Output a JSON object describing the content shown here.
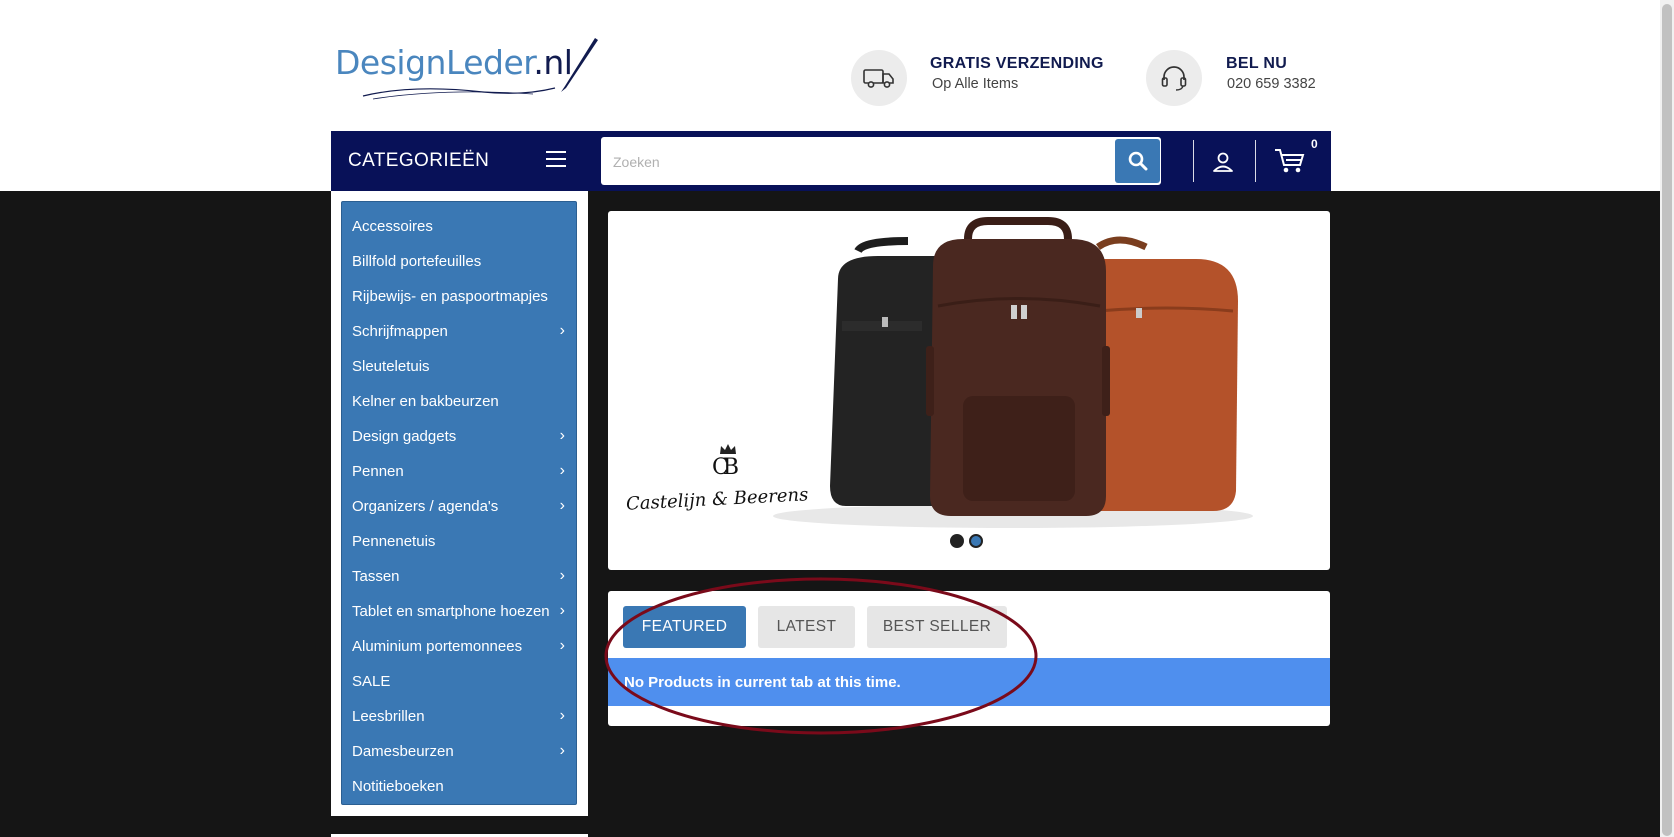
{
  "header": {
    "logo_text_a": "Design",
    "logo_text_b": "Leder",
    "logo_text_c": ".nl",
    "shipping_title": "GRATIS VERZENDING",
    "shipping_sub": "Op Alle Items",
    "call_title": "BEL NU",
    "call_number": "020 659 3382"
  },
  "navbar": {
    "categories_label": "CATEGORIEËN",
    "search_placeholder": "Zoeken",
    "cart_count": "0"
  },
  "sidebar": {
    "items": [
      {
        "label": "Accessoires",
        "has_submenu": false
      },
      {
        "label": "Billfold portefeuilles",
        "has_submenu": false
      },
      {
        "label": "Rijbewijs- en paspoortmapjes",
        "has_submenu": false
      },
      {
        "label": "Schrijfmappen",
        "has_submenu": true
      },
      {
        "label": "Sleuteletuis",
        "has_submenu": false
      },
      {
        "label": "Kelner en bakbeurzen",
        "has_submenu": false
      },
      {
        "label": "Design gadgets",
        "has_submenu": true
      },
      {
        "label": "Pennen",
        "has_submenu": true
      },
      {
        "label": "Organizers / agenda's",
        "has_submenu": true
      },
      {
        "label": "Pennenetuis",
        "has_submenu": false
      },
      {
        "label": "Tassen",
        "has_submenu": true
      },
      {
        "label": "Tablet en smartphone hoezen",
        "has_submenu": true
      },
      {
        "label": "Aluminium portemonnees",
        "has_submenu": true
      },
      {
        "label": "SALE",
        "has_submenu": false
      },
      {
        "label": "Leesbrillen",
        "has_submenu": true
      },
      {
        "label": "Damesbeurzen",
        "has_submenu": true
      },
      {
        "label": "Notitieboeken",
        "has_submenu": false
      }
    ]
  },
  "banner": {
    "brand_monogram": "CB",
    "brand_script": "Castelijn & Beerens",
    "slide_count": 2,
    "active_slide": 2
  },
  "tabs": {
    "items": [
      "FEATURED",
      "LATEST",
      "BEST SELLER"
    ],
    "active": "FEATURED",
    "empty_message": "No Products in current tab at this time."
  },
  "colors": {
    "navy": "#081158",
    "accent_blue": "#3a78b4",
    "notice_blue": "#4f8fee",
    "annotation_red": "#7a0a1a"
  }
}
